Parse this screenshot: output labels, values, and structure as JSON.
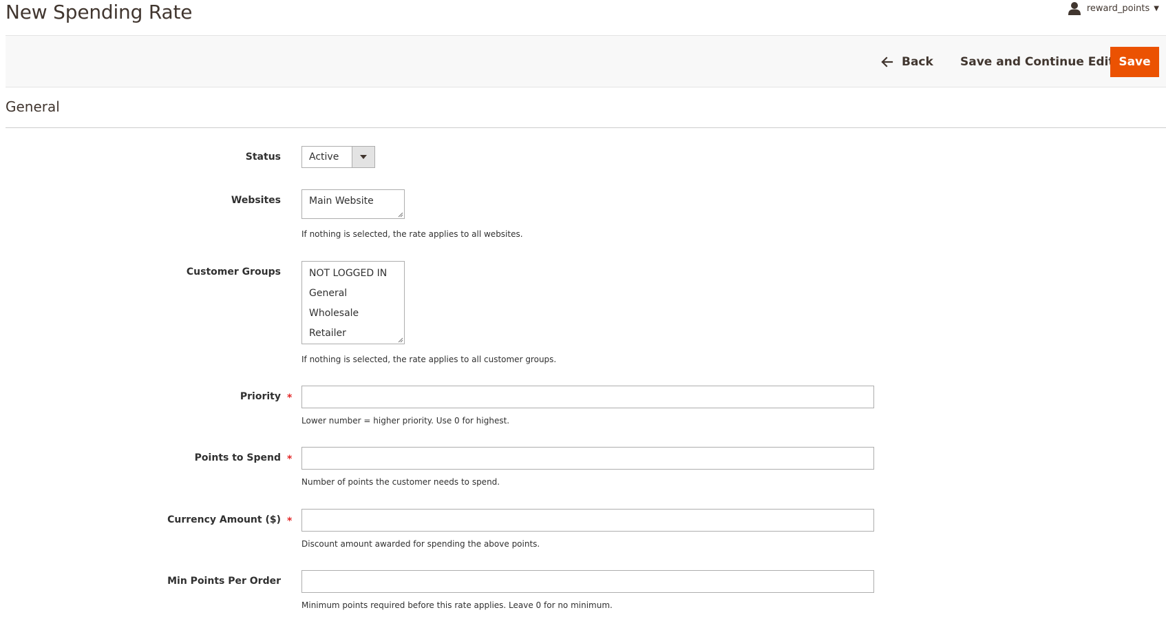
{
  "header": {
    "title": "New Spending Rate",
    "user_name": "reward_points"
  },
  "actions": {
    "back_label": "Back",
    "save_continue_label": "Save and Continue Edit",
    "save_label": "Save"
  },
  "section": {
    "title": "General"
  },
  "form": {
    "status": {
      "label": "Status",
      "value": "Active"
    },
    "websites": {
      "label": "Websites",
      "options": [
        "Main Website"
      ],
      "note": "If nothing is selected, the rate applies to all websites."
    },
    "customer_groups": {
      "label": "Customer Groups",
      "options": [
        "NOT LOGGED IN",
        "General",
        "Wholesale",
        "Retailer"
      ],
      "note": "If nothing is selected, the rate applies to all customer groups."
    },
    "priority": {
      "label": "Priority",
      "value": "",
      "required": true,
      "note": "Lower number = higher priority. Use 0 for highest."
    },
    "points_to_spend": {
      "label": "Points to Spend",
      "value": "",
      "required": true,
      "note": "Number of points the customer needs to spend."
    },
    "currency_amount": {
      "label": "Currency Amount ($)",
      "value": "",
      "required": true,
      "note": "Discount amount awarded for spending the above points."
    },
    "min_points": {
      "label": "Min Points Per Order",
      "value": "",
      "required": false,
      "note": "Minimum points required before this rate applies. Leave 0 for no minimum."
    }
  },
  "required_mark": "*",
  "colors": {
    "primary_button": "#eb5202",
    "required_star": "#e22626",
    "title_text": "#41362f"
  },
  "icons": {
    "user": "user-icon",
    "user_caret": "caret-down-icon",
    "back": "arrow-left-icon",
    "select": "caret-down-icon",
    "resize": "resize-handle-icon"
  }
}
